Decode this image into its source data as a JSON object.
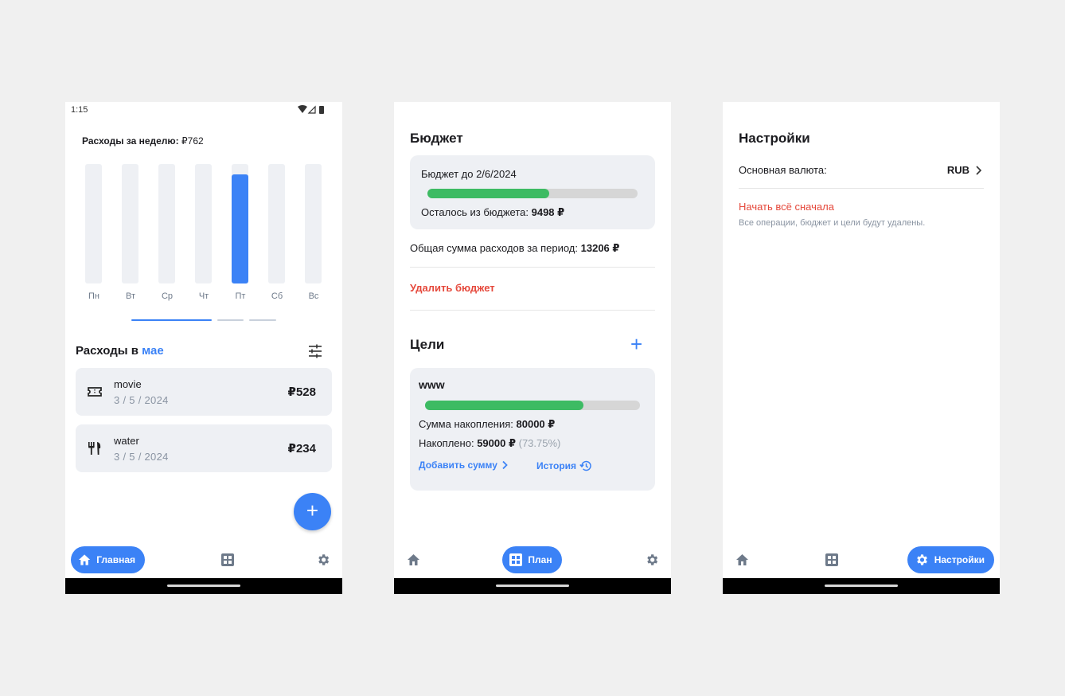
{
  "colors": {
    "accent": "#3b82f6",
    "success": "#3dbb63",
    "danger": "#e5483b",
    "card": "#eef0f4"
  },
  "home": {
    "status_time": "1:15",
    "week_label": "Расходы за неделю:",
    "week_total": "₽762",
    "days": [
      "Пн",
      "Вт",
      "Ср",
      "Чт",
      "Пт",
      "Сб",
      "Вс"
    ],
    "day_fill": [
      0,
      0,
      0,
      0,
      0.91,
      0,
      0
    ],
    "month_title_prefix": "Расходы в",
    "month_name": "мае",
    "transactions": [
      {
        "icon": "ticket-icon",
        "name": "movie",
        "date": "3 / 5 / 2024",
        "amount": "₽528"
      },
      {
        "icon": "fork-knife-icon",
        "name": "water",
        "date": "3 / 5 / 2024",
        "amount": "₽234"
      }
    ],
    "fab": "+"
  },
  "plan": {
    "budget_title": "Бюджет",
    "budget_until": "Бюджет до 2/6/2024",
    "budget_progress": 0.58,
    "remaining_label": "Осталось из бюджета:",
    "remaining_value": "9498 ₽",
    "total_label": "Общая сумма расходов за период:",
    "total_value": "13206 ₽",
    "delete_budget": "Удалить бюджет",
    "goals_title": "Цели",
    "add_goal": "+",
    "goal": {
      "name": "www",
      "progress": 0.7375,
      "target_label": "Сумма накопления:",
      "target_value": "80000 ₽",
      "saved_label": "Накоплено:",
      "saved_value": "59000 ₽",
      "saved_percent": "(73.75%)",
      "add_amount": "Добавить сумму",
      "history": "История"
    }
  },
  "settings": {
    "title": "Настройки",
    "currency_label": "Основная валюта:",
    "currency_value": "RUB",
    "reset_label": "Начать всё сначала",
    "reset_hint": "Все операции, бюджет и цели будут удалены."
  },
  "nav": {
    "home": "Главная",
    "plan": "План",
    "settings": "Настройки"
  }
}
